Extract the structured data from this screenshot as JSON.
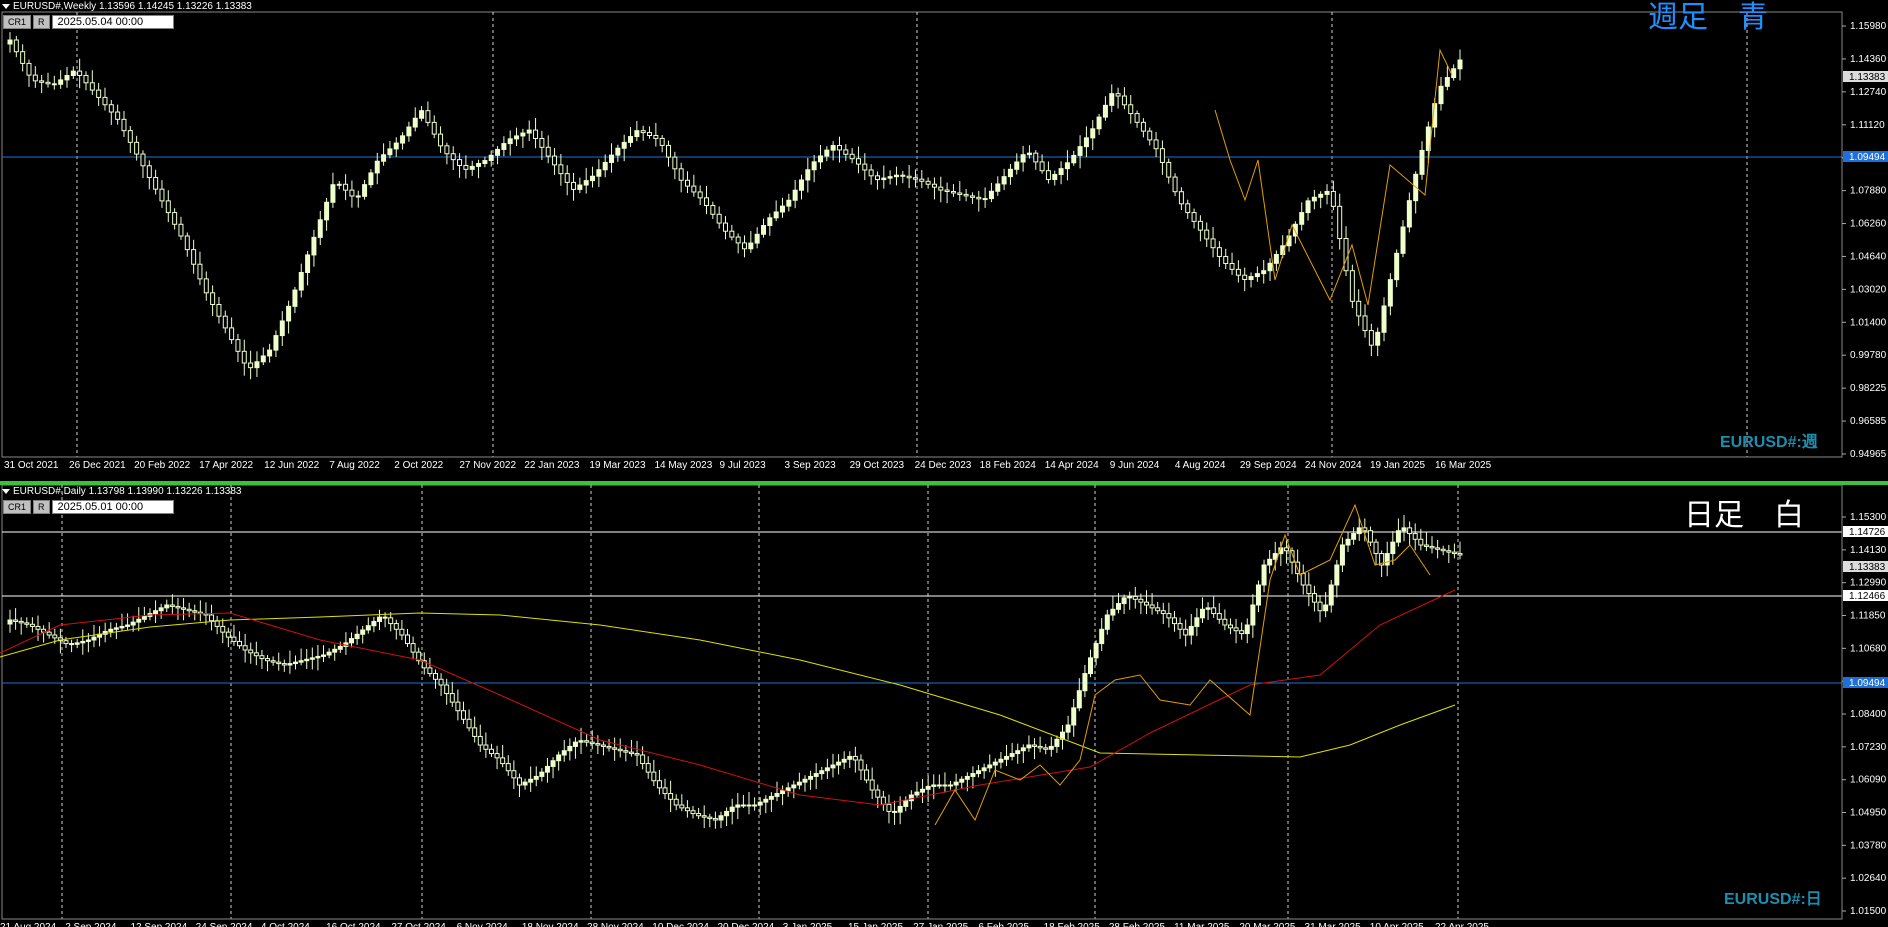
{
  "weekly": {
    "header": "EURUSD#,Weekly  1.13596 1.14245 1.13226 1.13383",
    "cr_label": "CR1",
    "r_label": "R",
    "date_value": "2025.05.04 00:00",
    "big_title": "週足　青",
    "symbol_label": "EURUSD#:週",
    "price_labels": [
      "1.15980",
      "1.14360",
      "1.12740",
      "1.11120",
      "1.09500",
      "1.07880",
      "1.06260",
      "1.04640",
      "1.03020",
      "1.01400",
      "0.99780",
      "0.98225",
      "0.96585",
      "0.94965"
    ],
    "current_price": "1.13383",
    "hline_price": "1.09494",
    "time_labels": [
      "31 Oct 2021",
      "26 Dec 2021",
      "20 Feb 2022",
      "17 Apr 2022",
      "12 Jun 2022",
      "7 Aug 2022",
      "2 Oct 2022",
      "27 Nov 2022",
      "22 Jan 2023",
      "19 Mar 2023",
      "14 May 2023",
      "9 Jul 2023",
      "3 Sep 2023",
      "29 Oct 2023",
      "24 Dec 2023",
      "18 Feb 2024",
      "14 Apr 2024",
      "9 Jun 2024",
      "4 Aug 2024",
      "29 Sep 2024",
      "24 Nov 2024",
      "19 Jan 2025",
      "16 Mar 2025"
    ],
    "colors": {
      "hline": "#1e6fd9",
      "ma": "#d01010",
      "zigzag": "#e0a000",
      "title": "#1e8fff",
      "candle": "#eeffcc"
    }
  },
  "daily": {
    "header": "EURUSD#,Daily  1.13798 1.13990 1.13226 1.13383",
    "cr_label": "CR1",
    "r_label": "R",
    "date_value": "2025.05.01 00:00",
    "big_title": "日足　白",
    "symbol_label": "EURUSD#:日",
    "price_labels": [
      "1.15300",
      "1.14130",
      "1.12990",
      "1.11850",
      "1.10680",
      "1.09494",
      "1.08400",
      "1.07230",
      "1.06090",
      "1.04950",
      "1.03780",
      "1.02640",
      "1.01500"
    ],
    "current_price": "1.13383",
    "hline_blue_price": "1.09494",
    "hline_white_upper": "1.14726",
    "hline_white_lower": "1.12466",
    "time_labels": [
      "21 Aug 2024",
      "2 Sep 2024",
      "12 Sep 2024",
      "24 Sep 2024",
      "4 Oct 2024",
      "16 Oct 2024",
      "27 Oct 2024",
      "6 Nov 2024",
      "18 Nov 2024",
      "28 Nov 2024",
      "10 Dec 2024",
      "20 Dec 2024",
      "3 Jan 2025",
      "15 Jan 2025",
      "27 Jan 2025",
      "6 Feb 2025",
      "18 Feb 2025",
      "28 Feb 2025",
      "11 Mar 2025",
      "20 Mar 2025",
      "31 Mar 2025",
      "10 Apr 2025",
      "22 Apr 2025"
    ],
    "colors": {
      "hline": "#1e6fd9",
      "ma": "#d01010",
      "ma_long": "#e0e000",
      "zigzag": "#e0a000",
      "title": "#ffffff",
      "candle": "#eeffcc"
    }
  }
}
